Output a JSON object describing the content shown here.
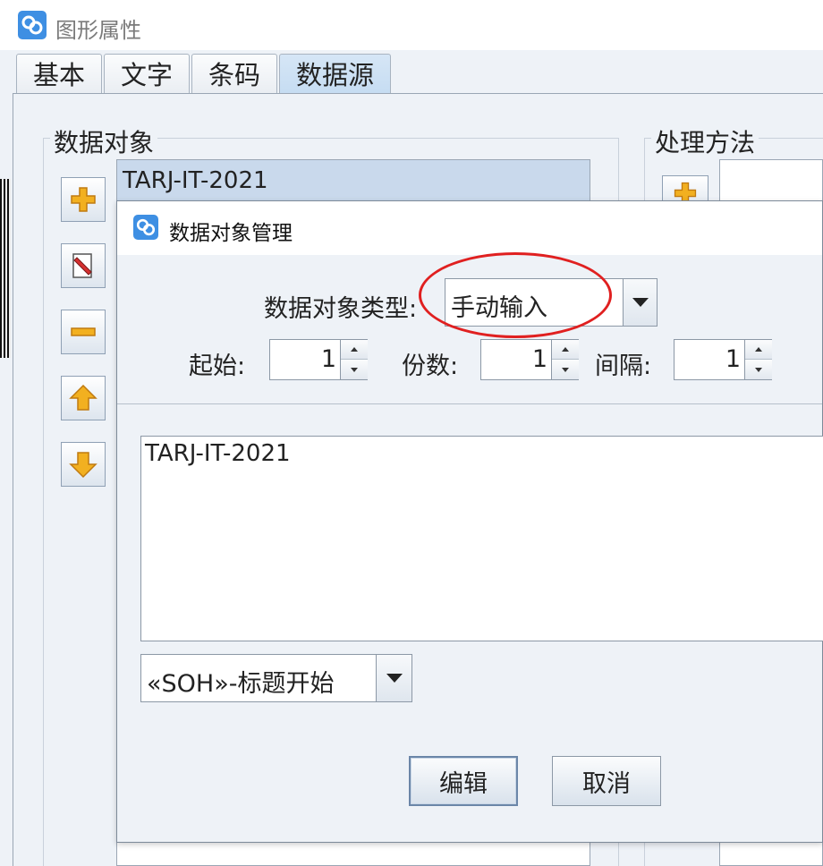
{
  "window": {
    "title": "图形属性"
  },
  "tabs": [
    {
      "label": "基本",
      "active": false
    },
    {
      "label": "文字",
      "active": false
    },
    {
      "label": "条码",
      "active": false
    },
    {
      "label": "数据源",
      "active": true
    }
  ],
  "data_object_group": {
    "legend": "数据对象",
    "items": [
      "TARJ-IT-2021"
    ],
    "buttons": [
      "add-icon",
      "edit-icon",
      "remove-icon",
      "move-up-icon",
      "move-down-icon"
    ]
  },
  "processing_group": {
    "legend": "处理方法"
  },
  "dialog": {
    "title": "数据对象管理",
    "type_label": "数据对象类型:",
    "type_value": "手动输入",
    "start_label": "起始:",
    "start_value": "1",
    "count_label": "份数:",
    "count_value": "1",
    "interval_label": "间隔:",
    "interval_value": "1",
    "text_content": "TARJ-IT-2021",
    "control_char_value": "«SOH»-标题开始",
    "edit_button": "编辑",
    "cancel_button": "取消"
  },
  "colors": {
    "highlight": "#e02020",
    "icon_orange": "#f2b020",
    "app_icon": "#3e8fe3",
    "selection": "#c9d9ec"
  }
}
